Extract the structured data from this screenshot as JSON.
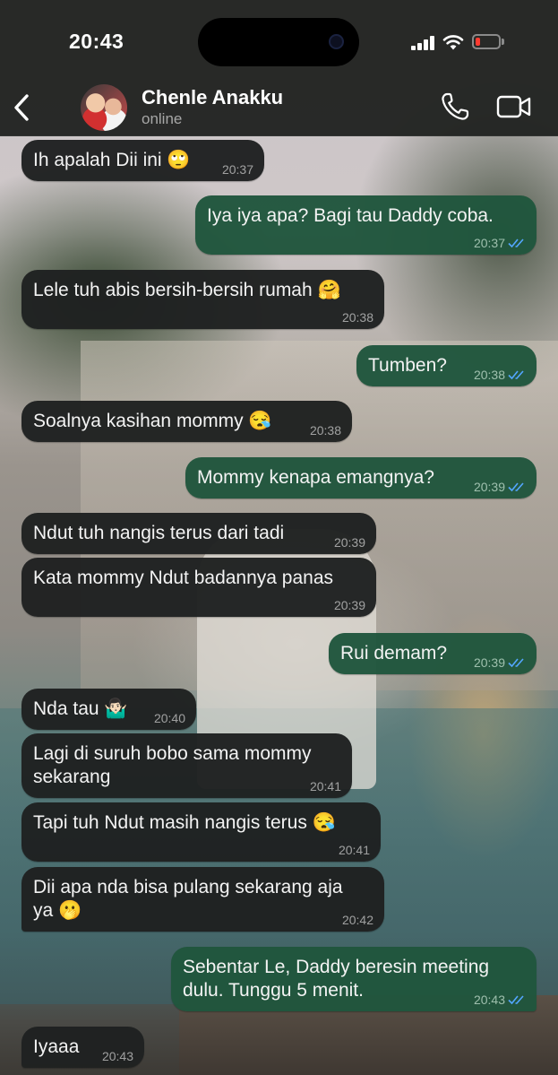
{
  "status_bar": {
    "time": "20:43"
  },
  "header": {
    "contact_name": "Chenle Anakku",
    "contact_status": "online"
  },
  "icons": {
    "back": "chevron-left-icon",
    "call": "phone-icon",
    "video": "video-camera-icon",
    "read_receipt": "double-check-icon"
  },
  "colors": {
    "incoming_bubble": "#1f2121",
    "outgoing_bubble": "#20563d",
    "read_ticks": "#53a6ff",
    "battery_low": "#ff3b30"
  },
  "messages": [
    {
      "dir": "in",
      "text": "Ih apalah Dii ini 🙄",
      "time": "20:37"
    },
    {
      "dir": "out",
      "text": "Iya iya apa? Bagi tau Daddy coba.",
      "time": "20:37"
    },
    {
      "dir": "in",
      "text": "Lele tuh abis bersih-bersih rumah 🤗",
      "time": "20:38"
    },
    {
      "dir": "out",
      "text": "Tumben?",
      "time": "20:38"
    },
    {
      "dir": "in",
      "text": "Soalnya kasihan mommy 😪",
      "time": "20:38"
    },
    {
      "dir": "out",
      "text": "Mommy kenapa emangnya?",
      "time": "20:39"
    },
    {
      "dir": "in",
      "text": "Ndut tuh nangis terus dari tadi",
      "time": "20:39"
    },
    {
      "dir": "in",
      "text": "Kata mommy Ndut badannya panas",
      "time": "20:39"
    },
    {
      "dir": "out",
      "text": "Rui demam?",
      "time": "20:39"
    },
    {
      "dir": "in",
      "text": "Nda tau 🤷🏻‍♂️",
      "time": "20:40"
    },
    {
      "dir": "in",
      "text": "Lagi di suruh bobo sama mommy\nsekarang",
      "time": "20:41"
    },
    {
      "dir": "in",
      "text": "Tapi tuh Ndut masih nangis terus 😪",
      "time": "20:41"
    },
    {
      "dir": "in",
      "text": "Dii apa nda bisa pulang sekarang aja\nya 🫢",
      "time": "20:42"
    },
    {
      "dir": "out",
      "text": "Sebentar Le, Daddy beresin meeting\ndulu. Tunggu 5 menit.",
      "time": "20:43"
    },
    {
      "dir": "in",
      "text": "Iyaaa",
      "time": "20:43"
    }
  ]
}
